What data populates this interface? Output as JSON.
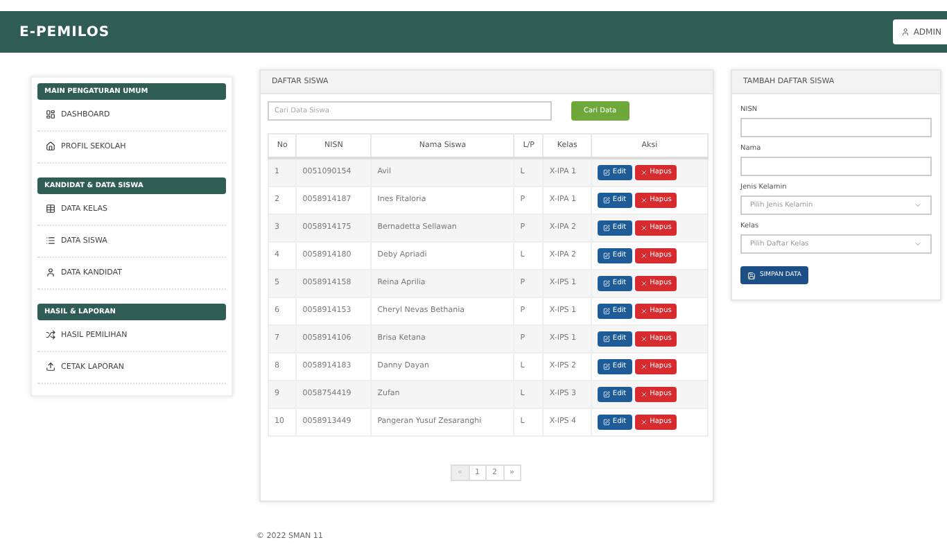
{
  "header": {
    "logo": "E-PEMILOS",
    "user_button": "ADMIN"
  },
  "sidebar": [
    {
      "title": "MAIN PENGATURAN UMUM",
      "items": [
        {
          "label": "DASHBOARD"
        },
        {
          "label": "PROFIL SEKOLAH"
        }
      ]
    },
    {
      "title": "KANDIDAT & DATA SISWA",
      "items": [
        {
          "label": "DATA KELAS"
        },
        {
          "label": "DATA SISWA"
        },
        {
          "label": "DATA KANDIDAT"
        }
      ]
    },
    {
      "title": "HASIL & LAPORAN",
      "items": [
        {
          "label": "HASIL PEMILIHAN"
        },
        {
          "label": "CETAK LAPORAN"
        }
      ]
    }
  ],
  "student_list": {
    "title": "DAFTAR SISWA",
    "search": {
      "placeholder": "Cari Data Siswa"
    },
    "search_button": "Cari Data",
    "table": {
      "columns": [
        "No",
        "NISN",
        "Nama Siswa",
        "L/P",
        "Kelas",
        "Aksi"
      ],
      "rows": [
        {
          "cells": [
            "1",
            "0051090154",
            "Avil",
            "L",
            "X-IPA 1"
          ],
          "edit": "Edit",
          "delete": "Hapus"
        },
        {
          "cells": [
            "2",
            "0058914187",
            "Ines Fitaloria",
            "P",
            "X-IPA 1"
          ],
          "edit": "Edit",
          "delete": "Hapus"
        },
        {
          "cells": [
            "3",
            "0058914175",
            "Bernadetta Sellawan",
            "P",
            "X-IPA 2"
          ],
          "edit": "Edit",
          "delete": "Hapus"
        },
        {
          "cells": [
            "4",
            "0058914180",
            "Deby Apriadi",
            "L",
            "X-IPA 2"
          ],
          "edit": "Edit",
          "delete": "Hapus"
        },
        {
          "cells": [
            "5",
            "0058914158",
            "Reina Aprilia",
            "P",
            "X-IPS 1"
          ],
          "edit": "Edit",
          "delete": "Hapus"
        },
        {
          "cells": [
            "6",
            "0058914153",
            "Cheryl Nevas Bethania",
            "P",
            "X-IPS 1"
          ],
          "edit": "Edit",
          "delete": "Hapus"
        },
        {
          "cells": [
            "7",
            "0058914106",
            "Brisa Ketana",
            "P",
            "X-IPS 1"
          ],
          "edit": "Edit",
          "delete": "Hapus"
        },
        {
          "cells": [
            "8",
            "0058914183",
            "Danny Dayan",
            "L",
            "X-IPS 2"
          ],
          "edit": "Edit",
          "delete": "Hapus"
        },
        {
          "cells": [
            "9",
            "0058754419",
            "Zufan",
            "L",
            "X-IPS 3"
          ],
          "edit": "Edit",
          "delete": "Hapus"
        },
        {
          "cells": [
            "10",
            "0058913449",
            "Pangeran Yusuf Zesaranghi",
            "L",
            "X-IPS 4"
          ],
          "edit": "Edit",
          "delete": "Hapus"
        }
      ]
    },
    "pagination": [
      {
        "label": "«",
        "disabled": true
      },
      {
        "label": "1",
        "disabled": false
      },
      {
        "label": "2",
        "disabled": false
      },
      {
        "label": "»",
        "disabled": false
      }
    ]
  },
  "add_form": {
    "title": "TAMBAH DAFTAR SISWA",
    "fields": [
      {
        "kind": "text",
        "label": "NISN"
      },
      {
        "kind": "text",
        "label": "Nama"
      },
      {
        "kind": "select",
        "label": "Jenis Kelamin",
        "placeholder": "Pilih Jenis Kelamin"
      },
      {
        "kind": "select",
        "label": "Kelas",
        "placeholder": "Pilih Daftar Kelas"
      }
    ],
    "submit": "SIMPAN DATA"
  },
  "footer": "© 2022 SMAN 11"
}
